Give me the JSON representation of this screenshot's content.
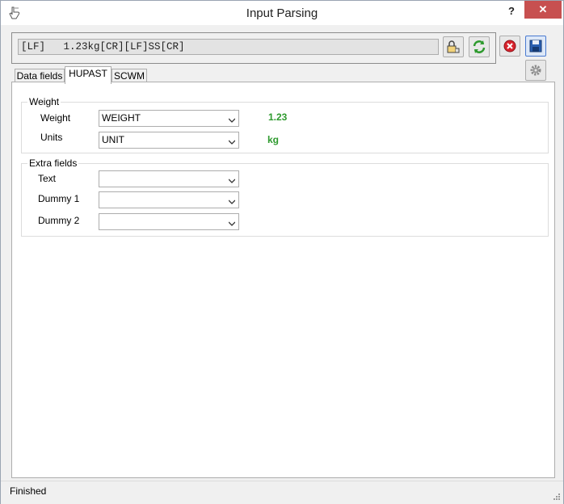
{
  "window": {
    "title": "Input Parsing",
    "help_label": "?",
    "close_label": "✕"
  },
  "raw_input": {
    "value": "[LF]   1.23kg[CR][LF]SS[CR]"
  },
  "tabs": [
    {
      "label": "Data fields",
      "active": false
    },
    {
      "label": "HUPAST",
      "active": true
    },
    {
      "label": "SCWM",
      "active": false
    }
  ],
  "weight_group": {
    "legend": "Weight",
    "fields": [
      {
        "label": "Weight",
        "selected": "WEIGHT",
        "value": "1.23"
      },
      {
        "label": "Units",
        "selected": "UNIT",
        "value": "kg"
      }
    ]
  },
  "extra_group": {
    "legend": "Extra fields",
    "fields": [
      {
        "label": "Text",
        "selected": ""
      },
      {
        "label": "Dummy 1",
        "selected": ""
      },
      {
        "label": "Dummy 2",
        "selected": ""
      }
    ]
  },
  "status": {
    "text": "Finished"
  },
  "colors": {
    "value_green": "#2e9a2e",
    "close_red": "#c75050",
    "cancel_red": "#d9232d",
    "save_blue": "#2a5fb0"
  },
  "icons": {
    "app": "hand-pointer-icon",
    "lock": "lock-icon",
    "refresh": "refresh-icon",
    "cancel": "cancel-icon",
    "save": "save-icon",
    "settings": "gear-icon"
  }
}
